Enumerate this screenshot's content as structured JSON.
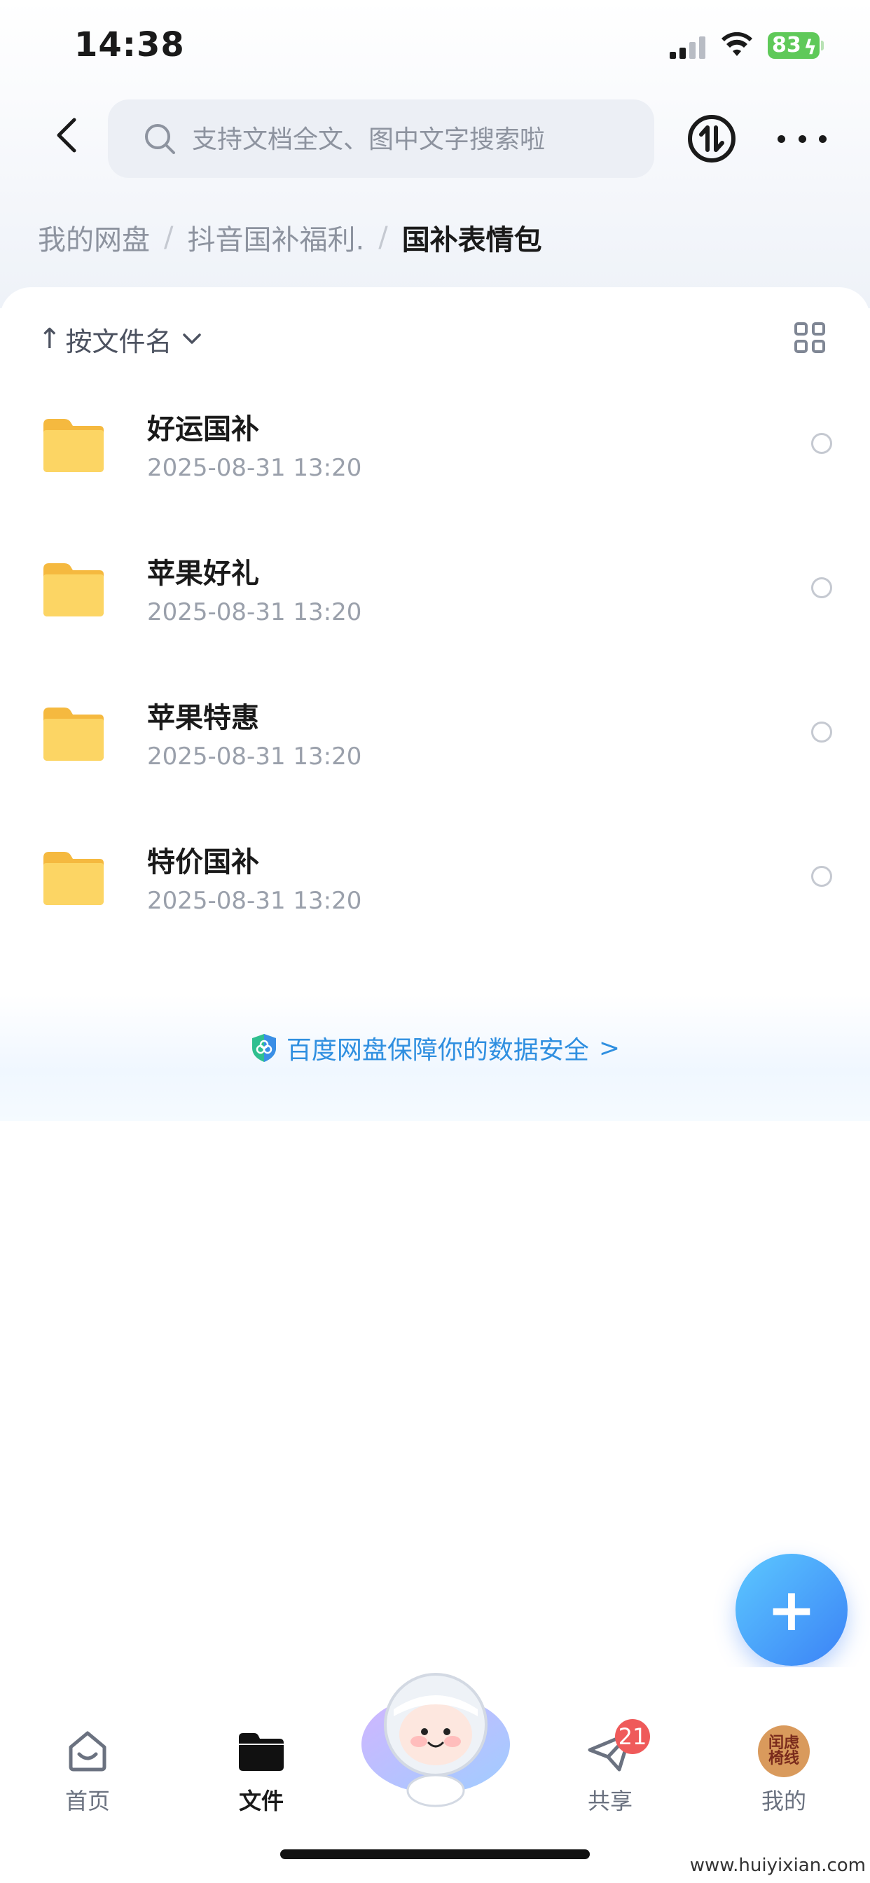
{
  "status_bar": {
    "time": "14:38",
    "battery": "83"
  },
  "header": {
    "search_placeholder": "支持文档全文、图中文字搜索啦",
    "icons": [
      "back-icon",
      "search-icon",
      "transfer-icon",
      "more-icon"
    ]
  },
  "breadcrumb": {
    "items": [
      "我的网盘",
      "抖音国补福利.",
      "国补表情包"
    ],
    "separator": "/"
  },
  "sort": {
    "label": "按文件名",
    "direction_symbol": "↑"
  },
  "files": [
    {
      "name": "好运国补",
      "date": "2025-08-31 13:20"
    },
    {
      "name": "苹果好礼",
      "date": "2025-08-31 13:20"
    },
    {
      "name": "苹果特惠",
      "date": "2025-08-31 13:20"
    },
    {
      "name": "特价国补",
      "date": "2025-08-31 13:20"
    }
  ],
  "safety_banner": {
    "text": "百度网盘保障你的数据安全",
    "arrow": ">"
  },
  "fab": {
    "symbol": "+"
  },
  "tab_bar": {
    "tabs": [
      {
        "label": "首页",
        "icon": "home-icon",
        "active": false
      },
      {
        "label": "文件",
        "icon": "folder-icon",
        "active": true
      },
      {
        "label": "",
        "icon": "mascot-icon",
        "active": false
      },
      {
        "label": "共享",
        "icon": "share-icon",
        "active": false,
        "badge": "21"
      },
      {
        "label": "我的",
        "icon": "avatar-icon",
        "active": false
      }
    ],
    "avatar_text": "闰虑椅线"
  },
  "watermark": "www.huiyixian.com",
  "colors": {
    "accent": "#3b82f6",
    "folder": "#fcd05b",
    "badge": "#ef5a5a",
    "link": "#2f8fe0"
  }
}
